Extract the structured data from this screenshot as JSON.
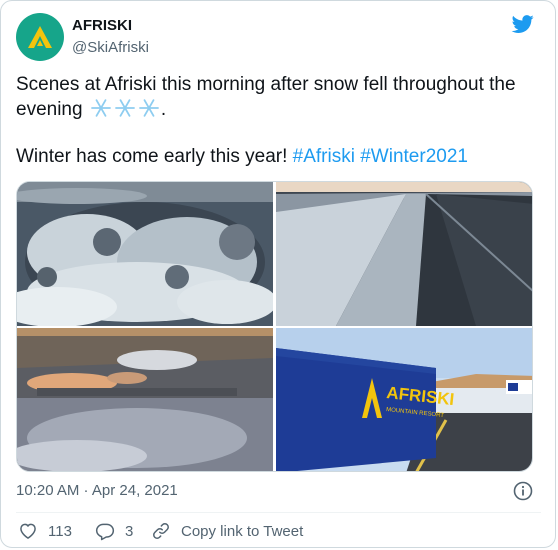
{
  "tweet": {
    "display_name": "AFRISKI",
    "handle": "@SkiAfriski",
    "text_line1": "Scenes at Afriski this morning after snow fell throughout the",
    "text_line2": "evening",
    "text_line2_end": ".",
    "text_line3": "Winter has come early this year!",
    "hashtag1": "#Afriski",
    "hashtag2": "#Winter2021",
    "timestamp": "10:20 AM · Apr 24, 2021",
    "likes": "113",
    "replies": "3",
    "copy_link_label": "Copy link to Tweet",
    "banner_text": "AFRISKI",
    "banner_subtext": "MOUNTAIN RESORT"
  },
  "icons": {
    "avatar": "afriski-logo-icon",
    "brand": "twitter-bird-icon",
    "emoji": "snowflake-icon",
    "info": "info-icon",
    "like": "heart-icon",
    "reply": "reply-icon",
    "copy": "link-icon"
  },
  "colors": {
    "accent": "#1d9bf0",
    "avatar_bg": "#16a58a",
    "logo_yellow": "#f2c40d",
    "secondary_text": "#536471"
  }
}
